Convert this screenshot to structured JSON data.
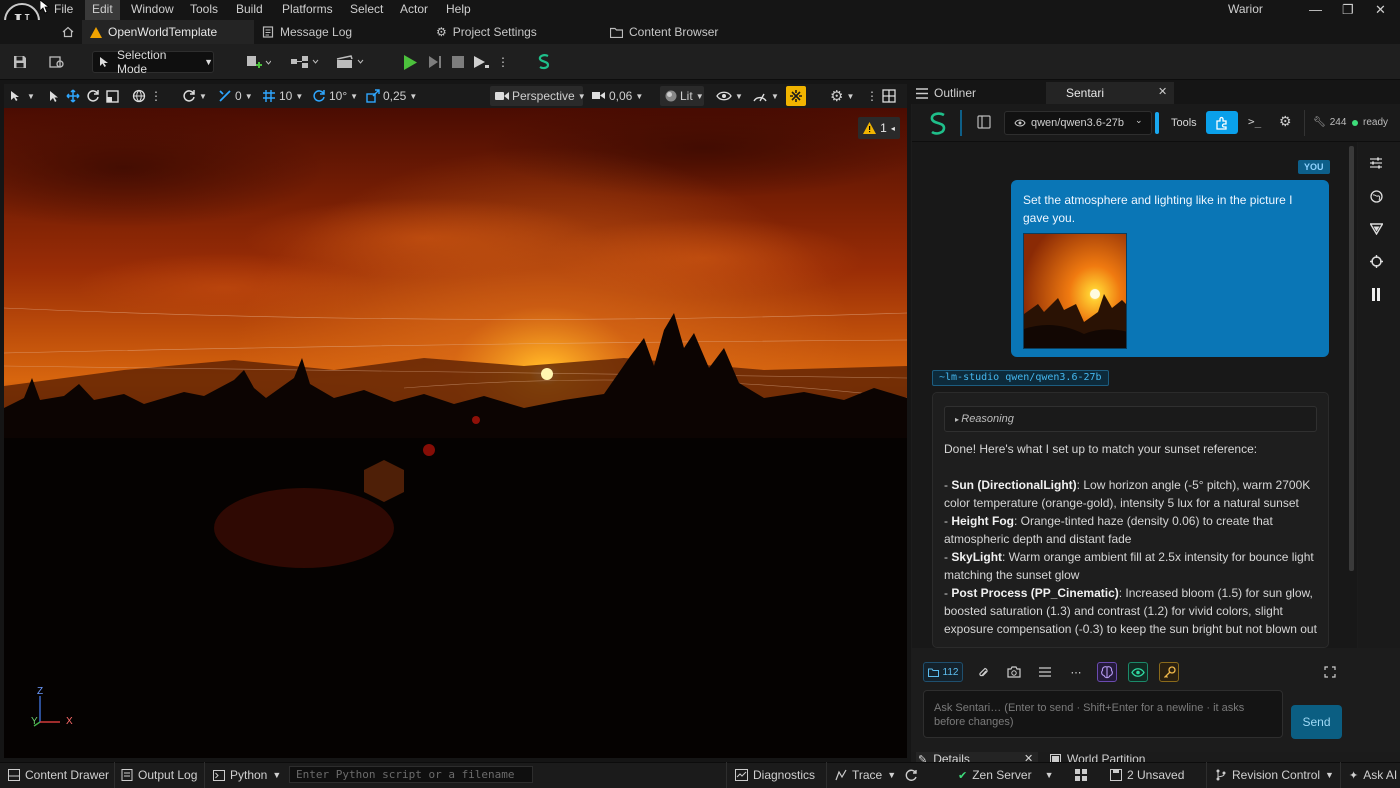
{
  "window": {
    "project_name": "Warior"
  },
  "menu": [
    "File",
    "Edit",
    "Window",
    "Tools",
    "Build",
    "Platforms",
    "Select",
    "Actor",
    "Help"
  ],
  "tabs": {
    "level": "OpenWorldTemplate",
    "message_log": "Message Log",
    "project_settings": "Project Settings",
    "content_browser": "Content Browser"
  },
  "toolbar": {
    "selection_mode": "Selection Mode"
  },
  "viewport": {
    "translate_snap": "0",
    "grid_snap": "10",
    "rotate_snap": "10°",
    "scale_snap": "0,25",
    "view_mode": "Perspective",
    "camera_speed": "0,06",
    "lighting": "Lit",
    "warning_count": "1",
    "axis": {
      "z": "Z",
      "y": "Y",
      "x": "X"
    }
  },
  "right_panel": {
    "tabs": {
      "outliner": "Outliner",
      "sentari": "Sentari"
    },
    "model": "qwen/qwen3.6-27b",
    "tools_label": "Tools",
    "token_count": "244",
    "status": "ready"
  },
  "chat": {
    "you_label": "YOU",
    "user_message": "Set the atmosphere and lighting like in the picture I gave you.",
    "assistant_tag": "~lm-studio qwen/qwen3.6-27b",
    "reasoning_label": "Reasoning",
    "intro": "Done! Here's what I set up to match your sunset reference:",
    "items": [
      {
        "title": "Sun (DirectionalLight)",
        "text": ": Low horizon angle (-5° pitch), warm 2700K color temperature (orange-gold), intensity 5 lux for a natural sunset"
      },
      {
        "title": "Height Fog",
        "text": ": Orange-tinted haze (density 0.06) to create that atmospheric depth and distant fade"
      },
      {
        "title": "SkyLight",
        "text": ": Warm orange ambient fill at 2.5x intensity for bounce light matching the sunset glow"
      },
      {
        "title": "Post Process (PP_Cinematic)",
        "text": ": Increased bloom (1.5) for sun glow, boosted saturation (1.3) and contrast (1.2) for vivid colors, slight exposure compensation (-0.3) to keep the sun bright but not blown out"
      }
    ],
    "context_count": "112",
    "input_placeholder": "Ask Sentari…   (Enter to send · Shift+Enter for a newline · it asks before changes)",
    "send_label": "Send"
  },
  "bottom_bar": {
    "content_drawer": "Content Drawer",
    "output_log": "Output Log",
    "python": "Python",
    "python_placeholder": "Enter Python script or a filename",
    "diagnostics": "Diagnostics",
    "trace": "Trace",
    "zen_server": "Zen Server",
    "unsaved": "2 Unsaved",
    "revision_control": "Revision Control",
    "ask_ai": "Ask AI"
  },
  "lower_panel_tabs": {
    "details": "Details",
    "world_partition": "World Partition"
  },
  "colors": {
    "accent": "#0a76b6",
    "play_green": "#4cc13c",
    "sentari_green": "#1fbf8a",
    "warning": "#f1b400"
  }
}
